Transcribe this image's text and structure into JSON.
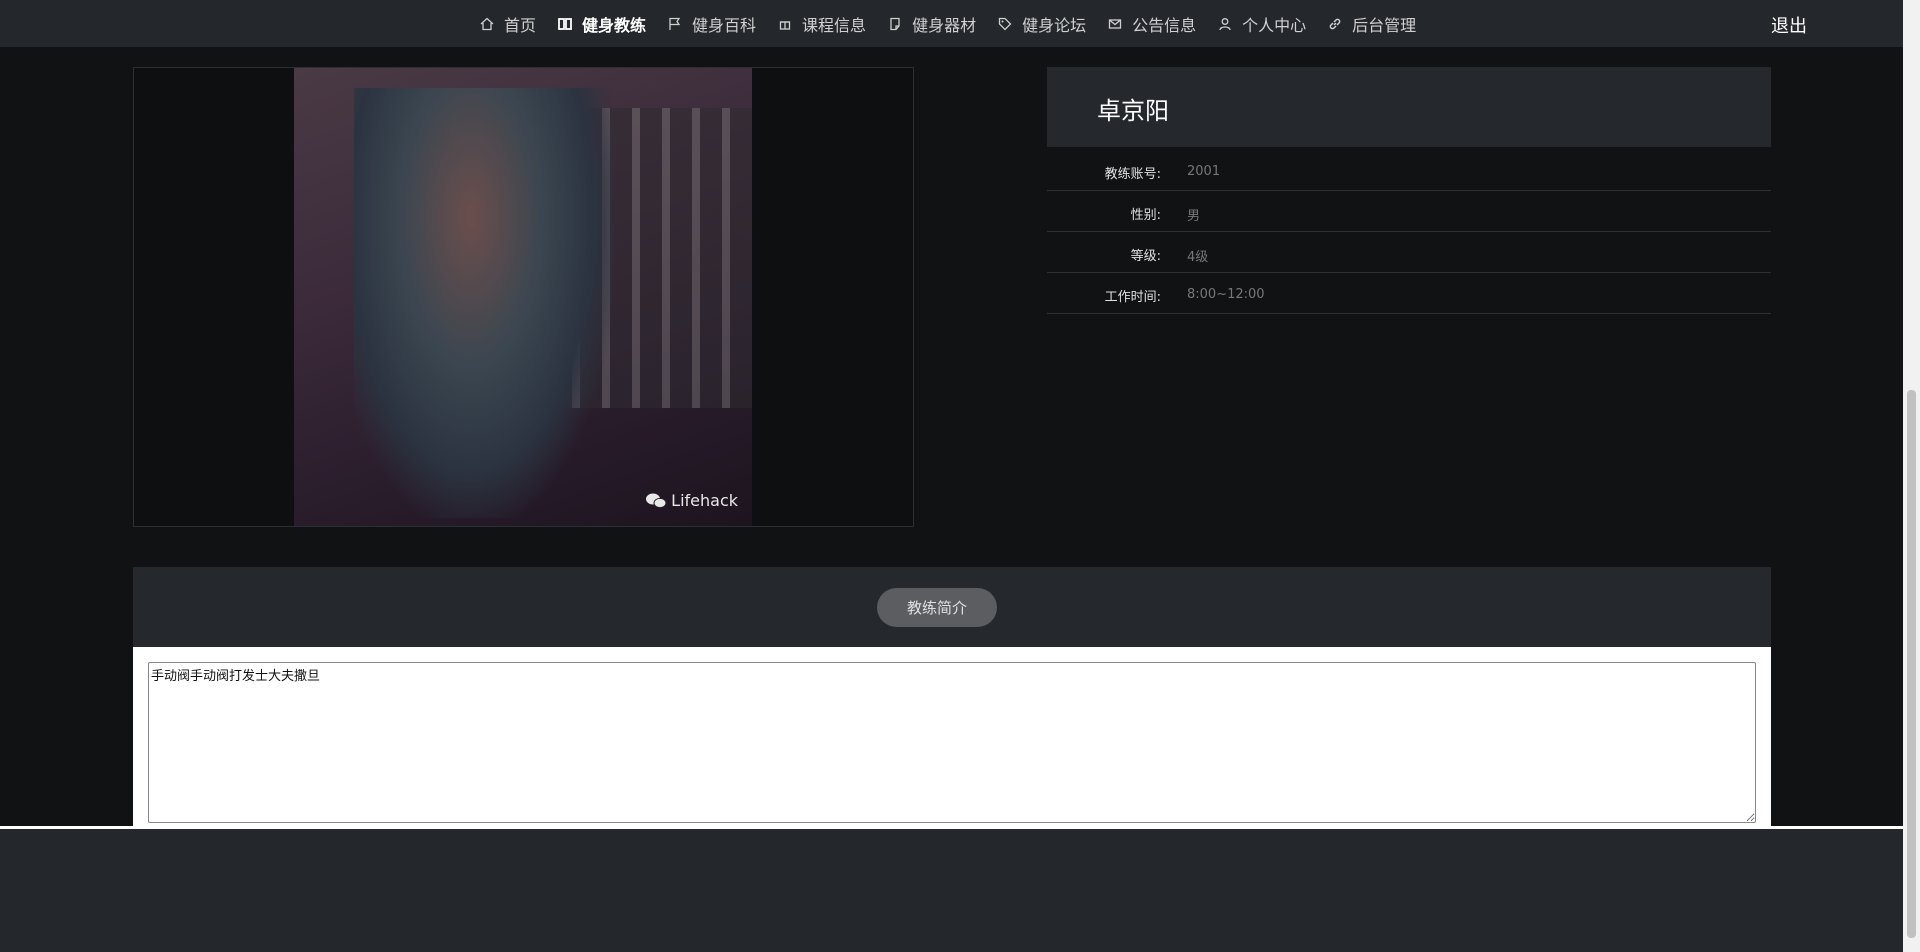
{
  "nav": {
    "items": [
      {
        "label": "首页",
        "icon": "home-icon"
      },
      {
        "label": "健身教练",
        "icon": "columns-icon",
        "active": true
      },
      {
        "label": "健身百科",
        "icon": "flag-icon"
      },
      {
        "label": "课程信息",
        "icon": "gift-icon"
      },
      {
        "label": "健身器材",
        "icon": "note-icon"
      },
      {
        "label": "健身论坛",
        "icon": "tag-icon"
      },
      {
        "label": "公告信息",
        "icon": "mail-icon"
      },
      {
        "label": "个人中心",
        "icon": "user-icon"
      },
      {
        "label": "后台管理",
        "icon": "link-icon"
      }
    ],
    "logout": "退出"
  },
  "photo": {
    "watermark": "Lifehack"
  },
  "coach": {
    "name": "卓京阳",
    "fields": [
      {
        "label": "教练账号:",
        "value": "2001"
      },
      {
        "label": "性别:",
        "value": "男"
      },
      {
        "label": "等级:",
        "value": "4级"
      },
      {
        "label": "工作时间:",
        "value": "8:00~12:00"
      }
    ]
  },
  "intro": {
    "button": "教练简介",
    "text": "手动阀手动阀打发士大夫撒旦"
  }
}
